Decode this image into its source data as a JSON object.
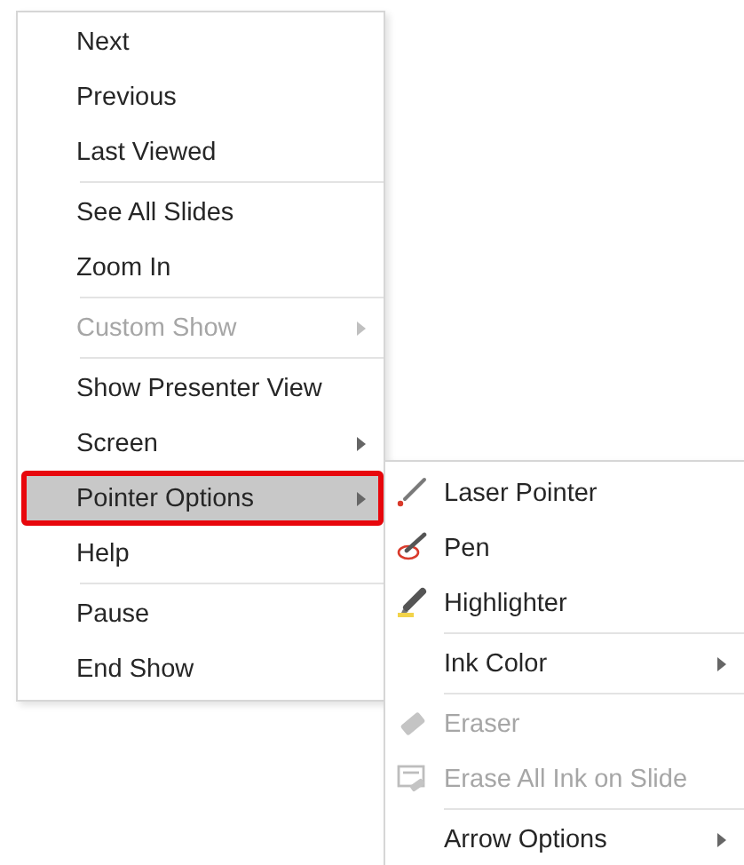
{
  "main_menu": {
    "items": [
      {
        "kind": "item",
        "label": "Next",
        "disabled": false,
        "submenu": false,
        "selected": false
      },
      {
        "kind": "item",
        "label": "Previous",
        "disabled": false,
        "submenu": false,
        "selected": false
      },
      {
        "kind": "item",
        "label": "Last Viewed",
        "disabled": false,
        "submenu": false,
        "selected": false
      },
      {
        "kind": "separator"
      },
      {
        "kind": "item",
        "label": "See All Slides",
        "disabled": false,
        "submenu": false,
        "selected": false
      },
      {
        "kind": "item",
        "label": "Zoom In",
        "disabled": false,
        "submenu": false,
        "selected": false
      },
      {
        "kind": "separator"
      },
      {
        "kind": "item",
        "label": "Custom Show",
        "disabled": true,
        "submenu": true,
        "selected": false
      },
      {
        "kind": "separator"
      },
      {
        "kind": "item",
        "label": "Show Presenter View",
        "disabled": false,
        "submenu": false,
        "selected": false
      },
      {
        "kind": "item",
        "label": "Screen",
        "disabled": false,
        "submenu": true,
        "selected": false
      },
      {
        "kind": "item",
        "label": "Pointer Options",
        "disabled": false,
        "submenu": true,
        "selected": true
      },
      {
        "kind": "item",
        "label": "Help",
        "disabled": false,
        "submenu": false,
        "selected": false
      },
      {
        "kind": "separator"
      },
      {
        "kind": "item",
        "label": "Pause",
        "disabled": false,
        "submenu": false,
        "selected": false
      },
      {
        "kind": "item",
        "label": "End Show",
        "disabled": false,
        "submenu": false,
        "selected": false
      }
    ]
  },
  "submenu": {
    "items": [
      {
        "kind": "laser",
        "label": "Laser Pointer",
        "disabled": false,
        "submenu": false,
        "selected": false
      },
      {
        "kind": "pen",
        "label": "Pen",
        "disabled": false,
        "submenu": false,
        "selected": false
      },
      {
        "kind": "highlighter",
        "label": "Highlighter",
        "disabled": false,
        "submenu": false,
        "selected": false
      },
      {
        "kind": "separator"
      },
      {
        "kind": "item",
        "label": "Ink Color",
        "disabled": false,
        "submenu": true,
        "selected": false
      },
      {
        "kind": "separator"
      },
      {
        "kind": "eraser",
        "label": "Eraser",
        "disabled": true,
        "submenu": false,
        "selected": false
      },
      {
        "kind": "clear",
        "label": "Erase All Ink on Slide",
        "disabled": true,
        "submenu": false,
        "selected": false
      },
      {
        "kind": "separator"
      },
      {
        "kind": "item",
        "label": "Arrow Options",
        "disabled": false,
        "submenu": true,
        "selected": false
      }
    ]
  }
}
